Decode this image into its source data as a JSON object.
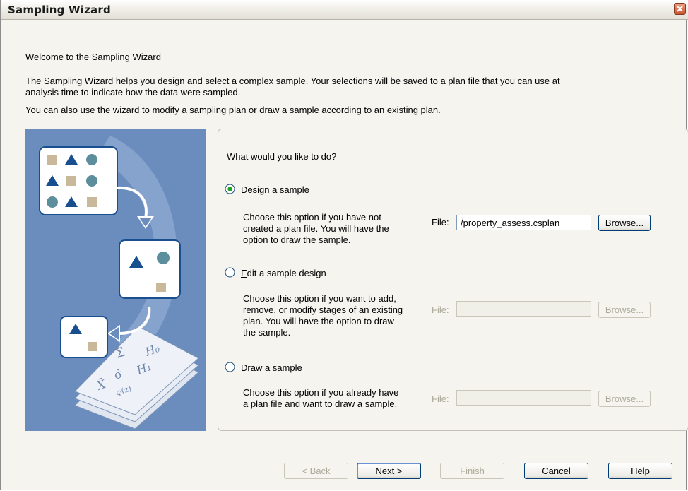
{
  "window": {
    "title": "Sampling Wizard"
  },
  "intro": {
    "heading": "Welcome to the Sampling Wizard",
    "line1a": "The Sampling Wizard helps you design and select a complex sample. Your selections will be saved to a plan file that you can use at",
    "line1b": "analysis time to indicate how the data were sampled.",
    "line2": "You can also use the wizard to modify a sampling plan or draw a sample according to an existing plan."
  },
  "panel": {
    "question": "What would you like to do?",
    "options": [
      {
        "label": "Design a sample",
        "selected": true,
        "desc": [
          "Choose this option if you have not",
          "created a plan file. You will have the",
          "option to draw the sample."
        ],
        "file_label": "File:",
        "file_value": "/property_assess.csplan",
        "browse": "Browse...",
        "enabled": true
      },
      {
        "label": "Edit a sample design",
        "selected": false,
        "desc": [
          "Choose this option if you want to add,",
          "remove, or modify stages of an existing",
          "plan. You will have the option to draw",
          "the sample."
        ],
        "file_label": "File:",
        "file_value": "",
        "browse": "Browse...",
        "enabled": false
      },
      {
        "label": "Draw a sample",
        "selected": false,
        "desc": [
          "Choose this option if you already have",
          "a plan file and want to draw a sample."
        ],
        "file_label": "File:",
        "file_value": "",
        "browse": "Browse...",
        "enabled": false
      }
    ]
  },
  "footer": {
    "back": "< Back",
    "next": "Next >",
    "finish": "Finish",
    "cancel": "Cancel",
    "help": "Help"
  },
  "colors": {
    "illustration_bg": "#6a8dbe",
    "shape_blue": "#1a4f8f",
    "shape_teal": "#5d8e9c",
    "shape_tan": "#c9b99a"
  },
  "illustration": {
    "formula_sigma": "Σ",
    "formula_h0": "H₀",
    "formula_h1": "H₁",
    "formula_sigma_hat": "σ̂",
    "formula_xbar": "X̄",
    "formula_phi": "φ(z)"
  }
}
